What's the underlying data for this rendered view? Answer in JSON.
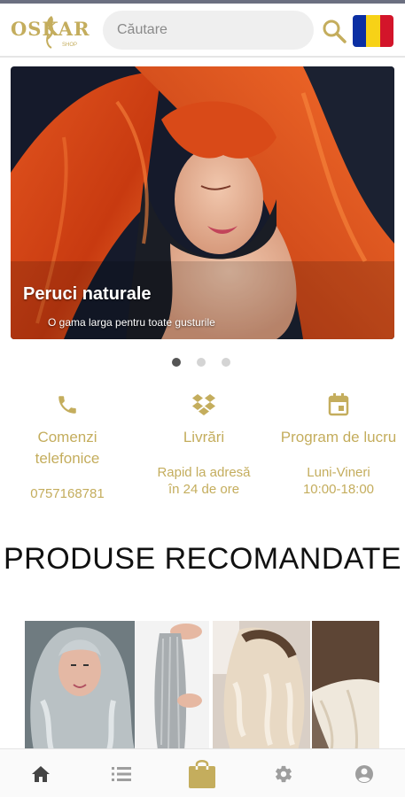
{
  "header": {
    "logo_text": "OSKAR",
    "logo_sub": "SHOP",
    "search_placeholder": "Căutare",
    "search_icon": "search-icon",
    "flag": "romania-flag",
    "flag_colors": [
      "#0b2fa3",
      "#f7d217",
      "#d3152a"
    ]
  },
  "hero": {
    "title": "Peruci naturale",
    "subtitle": "O gama larga pentru toate gusturile",
    "slides": 3,
    "active_slide": 1
  },
  "info": [
    {
      "icon": "phone-icon",
      "title": "Comenzi telefonice",
      "value": "0757168781"
    },
    {
      "icon": "dropbox-icon",
      "title": "Livrări",
      "value": "Rapid la adresă în 24 de ore"
    },
    {
      "icon": "calendar-icon",
      "title": "Program de lucru",
      "value": "Luni-Vineri 10:00-18:00"
    }
  ],
  "section": {
    "title": "PRODUSE RECOMANDATE"
  },
  "bottom_nav": [
    "home-icon",
    "list-icon",
    "shopping-bag-icon",
    "gear-icon",
    "account-icon"
  ],
  "colors": {
    "accent": "#c4ad5d",
    "nav_inactive": "#9e9e9e",
    "nav_home": "#444444"
  }
}
